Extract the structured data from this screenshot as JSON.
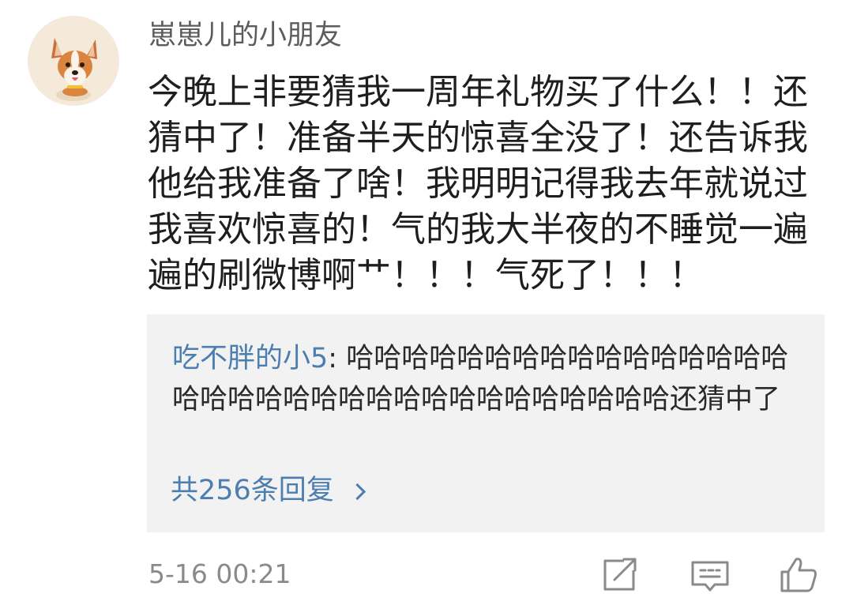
{
  "comment": {
    "author": "崽崽儿的小朋友",
    "text": "今晚上非要猜我一周年礼物买了什么！！还猜中了！准备半天的惊喜全没了！还告诉我他给我准备了啥！我明明记得我去年就说过我喜欢惊喜的！气的我大半夜的不睡觉一遍遍的刷微博啊艹！！！气死了！！！",
    "avatar_icon": "corgi-avatar-icon",
    "timestamp": "5-16 00:21"
  },
  "reply": {
    "author": "吃不胖的小5",
    "separator": ": ",
    "text": "哈哈哈哈哈哈哈哈哈哈哈哈哈哈哈哈哈哈哈哈哈哈哈哈哈哈哈哈哈哈哈哈哈哈还猜中了",
    "count_label": "共256条回复"
  },
  "actions": {
    "icons": [
      "share-icon",
      "comment-icon",
      "like-icon"
    ]
  },
  "colors": {
    "link_blue": "#4c7eaf",
    "reply_bg": "#f2f2f2",
    "meta_gray": "#8a8a8a"
  }
}
